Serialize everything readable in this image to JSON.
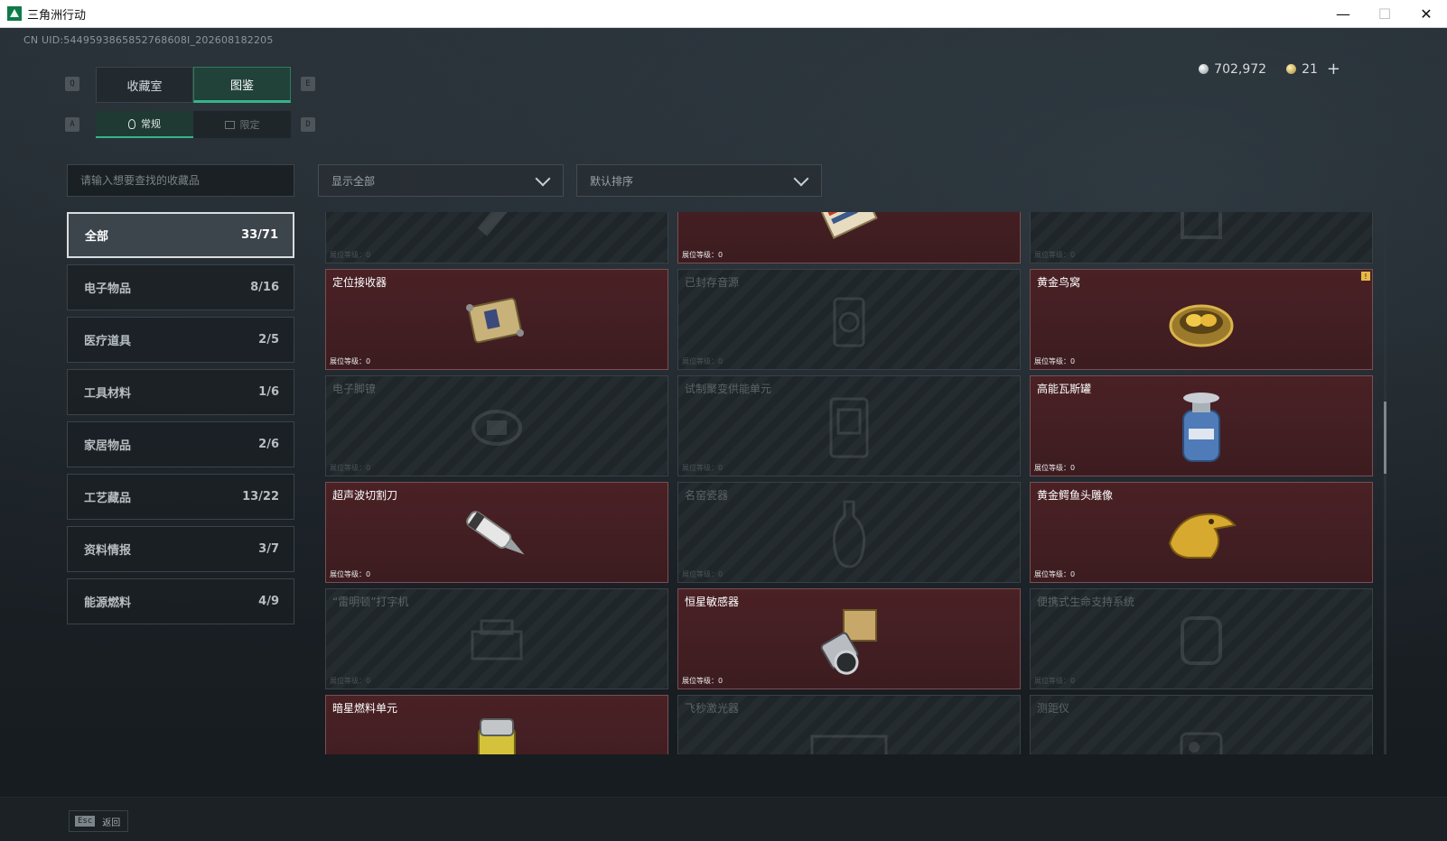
{
  "window": {
    "title": "三角洲行动",
    "minimize": "—",
    "maximize": "☐",
    "close": "✕"
  },
  "uid": "CN UID:5449593865852768608I_202608182205",
  "currency": {
    "silver_amount": "702,972",
    "gold_amount": "21",
    "add_label": "+"
  },
  "keys": {
    "prev_tab": "Q",
    "next_tab": "E",
    "prev_sub": "A",
    "next_sub": "D",
    "esc": "Esc"
  },
  "main_tabs": [
    "收藏室",
    "图鉴"
  ],
  "sub_tabs": [
    "常规",
    "限定"
  ],
  "search": {
    "placeholder": "请输入想要查找的收藏品"
  },
  "filter": {
    "value": "显示全部"
  },
  "sort": {
    "value": "默认排序"
  },
  "categories": [
    {
      "label": "全部",
      "count": "33/71"
    },
    {
      "label": "电子物品",
      "count": "8/16"
    },
    {
      "label": "医疗道具",
      "count": "2/5"
    },
    {
      "label": "工具材料",
      "count": "1/6"
    },
    {
      "label": "家居物品",
      "count": "2/6"
    },
    {
      "label": "工艺藏品",
      "count": "13/22"
    },
    {
      "label": "资料情报",
      "count": "3/7"
    },
    {
      "label": "能源燃料",
      "count": "4/9"
    }
  ],
  "level_label": "展位等级：0",
  "items": [
    {
      "name": "",
      "owned": false,
      "icon": "tool-icon"
    },
    {
      "name": "",
      "owned": true,
      "icon": "card-icon"
    },
    {
      "name": "",
      "owned": false,
      "icon": "frame-icon"
    },
    {
      "name": "定位接收器",
      "owned": true,
      "icon": "receiver-icon"
    },
    {
      "name": "已封存音源",
      "owned": false,
      "icon": "audio-icon"
    },
    {
      "name": "黄金鸟窝",
      "owned": true,
      "icon": "golden-nest-icon",
      "new": true
    },
    {
      "name": "电子脚镣",
      "owned": false,
      "icon": "ankle-monitor-icon"
    },
    {
      "name": "试制聚变供能单元",
      "owned": false,
      "icon": "fusion-unit-icon"
    },
    {
      "name": "高能瓦斯罐",
      "owned": true,
      "icon": "gas-tank-icon"
    },
    {
      "name": "超声波切割刀",
      "owned": true,
      "icon": "ultrasonic-cutter-icon"
    },
    {
      "name": "名窑瓷器",
      "owned": false,
      "icon": "porcelain-vase-icon"
    },
    {
      "name": "黄金鳄鱼头雕像",
      "owned": true,
      "icon": "gold-crocodile-icon"
    },
    {
      "name": "“雷明顿”打字机",
      "owned": false,
      "icon": "typewriter-icon"
    },
    {
      "name": "恒星敏感器",
      "owned": true,
      "icon": "star-sensor-icon"
    },
    {
      "name": "便携式生命支持系统",
      "owned": false,
      "icon": "life-support-icon"
    },
    {
      "name": "暗星燃料单元",
      "owned": true,
      "icon": "fuel-cell-icon"
    },
    {
      "name": "飞秒激光器",
      "owned": false,
      "icon": "laser-icon"
    },
    {
      "name": "测距仪",
      "owned": false,
      "icon": "rangefinder-icon"
    }
  ],
  "new_flag": "!",
  "footer": {
    "back_label": "返回"
  }
}
